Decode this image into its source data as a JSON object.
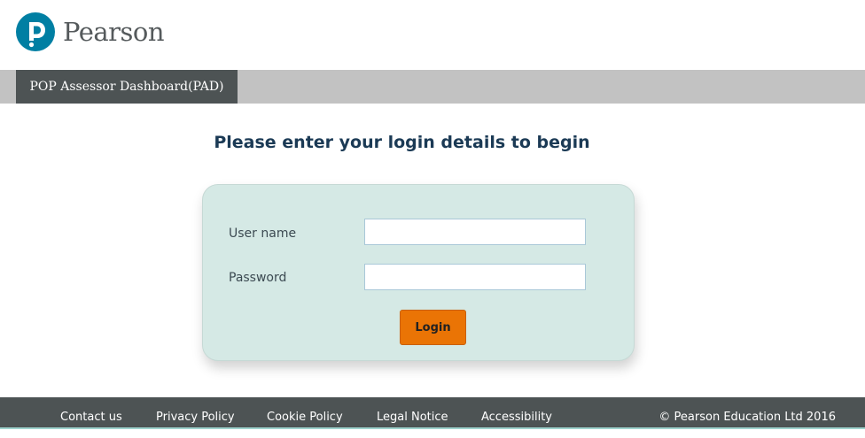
{
  "brand": {
    "name": "Pearson",
    "color": "#007fa3"
  },
  "nav": {
    "tab_label": "POP Assessor Dashboard(PAD)"
  },
  "login": {
    "heading": "Please enter your login details to begin",
    "username_label": "User name",
    "username_value": "",
    "password_label": "Password",
    "password_value": "",
    "submit_label": "Login"
  },
  "footer": {
    "links": [
      "Contact us",
      "Privacy Policy",
      "Cookie Policy",
      "Legal Notice",
      "Accessibility"
    ],
    "copyright": "© Pearson Education Ltd 2016"
  },
  "colors": {
    "nav_dark": "#4d5354",
    "nav_light": "#c2c2c2",
    "panel_bg": "#d5e9e5",
    "button_orange": "#ea7405",
    "heading_navy": "#1b3a55"
  },
  "icons": {
    "logo": "pearson-logo-icon"
  }
}
